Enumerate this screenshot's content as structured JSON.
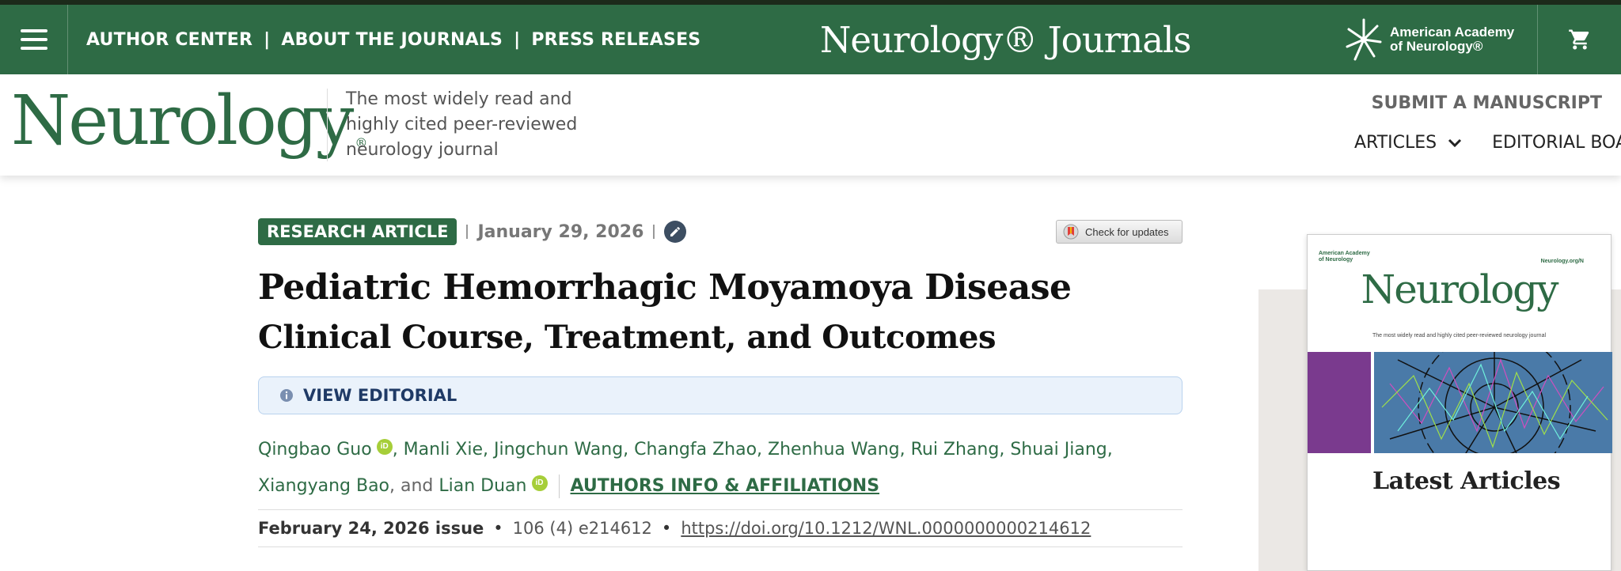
{
  "topbar": {
    "nav": [
      "AUTHOR CENTER",
      "ABOUT THE JOURNALS",
      "PRESS RELEASES"
    ],
    "separator": "|",
    "brand": "Neurology® Journals",
    "aan_line1": "American Academy",
    "aan_line2": "of Neurology®",
    "colors": {
      "bar": "#2e6b45",
      "topline": "#1c2a1a"
    }
  },
  "header": {
    "logo": "Neurology",
    "logo_mark": "®",
    "tagline": "The most widely read and highly cited peer-reviewed neurology journal",
    "submit": "SUBMIT A MANUSCRIPT",
    "nav": [
      "ARTICLES",
      "EDITORIAL BOA"
    ]
  },
  "article": {
    "type": "RESEARCH ARTICLE",
    "date": "January 29, 2026",
    "check_updates": "Check for updates",
    "title": "Pediatric Hemorrhagic Moyamoya Disease",
    "subtitle": "Clinical Course, Treatment, and Outcomes",
    "view_editorial": "VIEW EDITORIAL",
    "authors_first": "Qingbao Guo",
    "authors_middle": ", Manli Xie, Jingchun Wang, Changfa Zhao, Zhenhua Wang, Rui Zhang, Shuai Jiang, Xiangyang Bao",
    "and": ", and ",
    "authors_last": "Lian Duan",
    "affiliations": "AUTHORS INFO & AFFILIATIONS",
    "issue": "February 24, 2026 issue",
    "volume": "106 (4) e214612",
    "doi": "https://doi.org/10.1212/WNL.0000000000214612"
  },
  "sidebar": {
    "cover_aan_line1": "American Academy",
    "cover_aan_line2": "of Neurology",
    "cover_url": "Neurology.org/N",
    "cover_logo": "Neurology",
    "cover_tagline": "The most widely read and highly cited peer-reviewed neurology journal",
    "latest": "Latest Articles"
  },
  "icons": [
    "menu-icon",
    "aan-logo-icon",
    "cart-icon",
    "edit-icon",
    "check-updates-icon",
    "info-icon",
    "orcid-icon",
    "chevron-down-icon"
  ]
}
